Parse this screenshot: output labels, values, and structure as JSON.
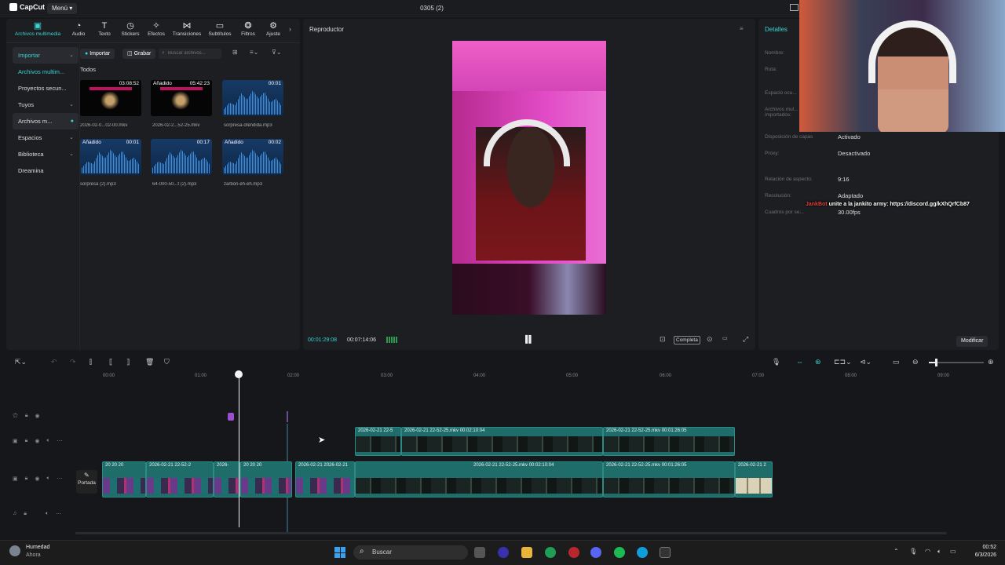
{
  "app": {
    "name": "CapCut",
    "menu": "Menú",
    "project_title": "0305 (2)"
  },
  "toolbar": {
    "tools": [
      {
        "label": "Archivos multimedia",
        "icon": "media-icon"
      },
      {
        "label": "Audio",
        "icon": "audio-icon"
      },
      {
        "label": "Texto",
        "icon": "text-icon"
      },
      {
        "label": "Stickers",
        "icon": "sticker-icon"
      },
      {
        "label": "Efectos",
        "icon": "effects-icon"
      },
      {
        "label": "Transiciones",
        "icon": "transition-icon"
      },
      {
        "label": "Subtítulos",
        "icon": "subtitles-icon"
      },
      {
        "label": "Filtros",
        "icon": "filter-icon"
      },
      {
        "label": "Ajuste",
        "icon": "adjust-icon"
      }
    ]
  },
  "media": {
    "nav": [
      {
        "label": "Importar",
        "chevron": true
      },
      {
        "label": "Archivos multim..."
      },
      {
        "label": "Proyectos secun..."
      },
      {
        "label": "Tuyos",
        "chevron": true
      },
      {
        "label": "Archivos m...",
        "chevron": true
      },
      {
        "label": "Espacios",
        "chevron": true
      },
      {
        "label": "Biblioteca",
        "chevron": true
      },
      {
        "label": "Dreamina"
      }
    ],
    "import_label": "Importar",
    "record_label": "Grabar",
    "search_placeholder": "Buscar archivos...",
    "section": "Todos",
    "items": [
      {
        "name": "2026-02-0...02-00.mkv",
        "duration": "03:08:52",
        "tag": "",
        "kind": "video"
      },
      {
        "name": "2026-02-2...52-25.mkv",
        "duration": "05:42:23",
        "tag": "Añadido",
        "kind": "video"
      },
      {
        "name": "sorpresa-ofendida.mp3",
        "duration": "00:01",
        "tag": "",
        "kind": "audio"
      },
      {
        "name": "sorpresa (2).mp3",
        "duration": "00:01",
        "tag": "Añadido",
        "kind": "audio"
      },
      {
        "name": "64-000-50...t (2).mp3",
        "duration": "00:17",
        "tag": "",
        "kind": "audio"
      },
      {
        "name": "zarbon-eh-eh.mp3",
        "duration": "00:02",
        "tag": "Añadido",
        "kind": "audio"
      }
    ]
  },
  "player": {
    "title": "Reproductor",
    "current_time": "00:01:29:08",
    "total_time": "00:07:14:06",
    "ratio_label": "Completa"
  },
  "details": {
    "title": "Detalles",
    "rows": [
      {
        "label": "Nombre:",
        "value": ""
      },
      {
        "label": "Ruta:",
        "value": ""
      },
      {
        "label": "Espacio ocu...",
        "value": ""
      },
      {
        "label": "Archivos mul... importados:",
        "value": ""
      },
      {
        "label": "Disposición de capas",
        "value": "Activado"
      },
      {
        "label": "Proxy:",
        "value": "Desactivado"
      },
      {
        "label": "Relación de aspecto:",
        "value": "9:16"
      },
      {
        "label": "Resolución:",
        "value": "Adaptado"
      },
      {
        "label": "Cuadros por se...",
        "value": "30.00fps"
      }
    ],
    "modify_label": "Modificar"
  },
  "chat": {
    "user": "JankBot",
    "message": "unite a la jankito army: https://discord.gg/kXhQrfCb87"
  },
  "timeline": {
    "ruler": [
      "00:00",
      "01:00",
      "02:00",
      "03:00",
      "04:00",
      "05:00",
      "06:00",
      "07:00",
      "08:00",
      "09:00"
    ],
    "cover_label": "Portada",
    "clips_top": [
      {
        "label": "2026-02-21 22-5"
      },
      {
        "label": "2026-02-21 22-52-25.mkv  00:02:10:04"
      },
      {
        "label": "2026-02-21 22-52-25.mkv  00:01:26:05"
      }
    ],
    "clips_main": [
      {
        "label": "20 20 20"
      },
      {
        "label": "2026-02-21 22-52-2"
      },
      {
        "label": "2026-"
      },
      {
        "label": "20 20 20"
      },
      {
        "label": "2026-02-21 2026-02-21"
      },
      {
        "label": "2026-02-21 22-52-25.mkv  00:02:10:04"
      },
      {
        "label": "2026-02-21 22-52-25.mkv  00:01:26:05"
      },
      {
        "label": "2026-02-21 2"
      }
    ]
  },
  "taskbar": {
    "weather_title": "Humedad",
    "weather_sub": "Ahora",
    "search_placeholder": "Buscar",
    "time": "00:52",
    "date": "6/3/2026"
  }
}
